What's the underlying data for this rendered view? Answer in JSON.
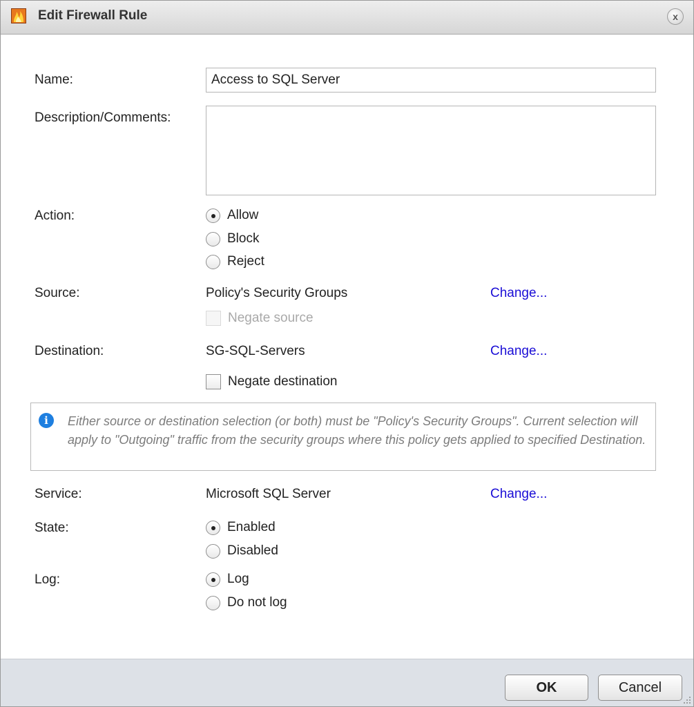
{
  "dialog": {
    "title": "Edit Firewall Rule",
    "close_label": "x"
  },
  "form": {
    "name": {
      "label": "Name:",
      "value": "Access to SQL Server"
    },
    "description": {
      "label": "Description/Comments:",
      "value": ""
    },
    "action": {
      "label": "Action:",
      "options": [
        "Allow",
        "Block",
        "Reject"
      ],
      "selected": "Allow"
    },
    "source": {
      "label": "Source:",
      "value": "Policy's Security Groups",
      "change_label": "Change...",
      "negate_label": "Negate source",
      "negate_checked": false,
      "negate_disabled": true
    },
    "destination": {
      "label": "Destination:",
      "value": "SG-SQL-Servers",
      "change_label": "Change...",
      "negate_label": "Negate destination",
      "negate_checked": false
    },
    "info_text": "Either source or destination selection (or both) must be \"Policy's Security Groups\". Current selection will apply to \"Outgoing\" traffic from the security groups where this policy gets applied to specified Destination.",
    "service": {
      "label": "Service:",
      "value": "Microsoft SQL Server",
      "change_label": "Change..."
    },
    "state": {
      "label": "State:",
      "options": [
        "Enabled",
        "Disabled"
      ],
      "selected": "Enabled"
    },
    "log": {
      "label": "Log:",
      "options": [
        "Log",
        "Do not log"
      ],
      "selected": "Log"
    }
  },
  "footer": {
    "ok_label": "OK",
    "cancel_label": "Cancel"
  },
  "colors": {
    "link": "#1a0dd6",
    "info_icon": "#1e7fe0",
    "footer_bg": "#dde1e7",
    "title_icon": "#e8791e"
  },
  "icons": {
    "title": "firewall-icon",
    "close": "close-icon",
    "info": "info-icon",
    "grip": "resize-grip-icon"
  }
}
